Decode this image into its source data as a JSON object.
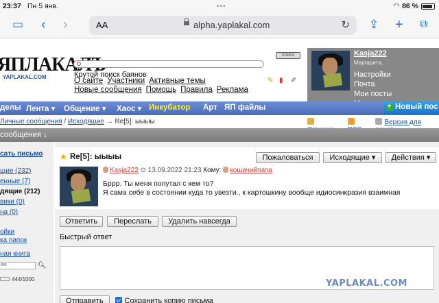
{
  "status": {
    "time": "23:37",
    "date": "Пн 5 янв.",
    "battery": "86 %",
    "battery_level": 0.86
  },
  "browser": {
    "aa": "AA",
    "url": "alpha.yaplakal.com"
  },
  "site": {
    "logo": "ЯПЛАКАЛЪ",
    "logo_sub": "YAPLAKAL.COM",
    "search_toggle": "поиск",
    "search_hint": "Крутой поиск баянов",
    "nav": [
      "О сайте",
      "Участники",
      "Активные темы",
      "Новые сообщения",
      "Помощь",
      "Правила",
      "Реклама"
    ]
  },
  "user": {
    "name": "Kasja222",
    "real_name": "Маргарита...",
    "links": [
      "Настройки",
      "Почта",
      "Мои посты",
      "Мои темы"
    ]
  },
  "menu": {
    "items": [
      "делы",
      "Лента ▾",
      "Общение ▾",
      "Хаос ▾",
      "Инкубатор",
      "Арт",
      "ЯП файлы"
    ],
    "new_post": "Новый пос"
  },
  "breadcrumb": {
    "part1": "Личные сообщения",
    "part2": "Исходящие",
    "current": "→ Re[5]: ыыыы"
  },
  "tools": [
    "Справка",
    "RSS",
    "Версия для печат"
  ],
  "section": "сообщения ↓",
  "sidebar": {
    "write": "сать письмо",
    "folders": [
      {
        "label": "щие (232)",
        "bold": false
      },
      {
        "label": "енные (7)",
        "bold": false
      },
      {
        "label": "дящие (212)",
        "bold": true
      },
      {
        "label": "вики (0)",
        "bold": false
      },
      {
        "label": "на (0)",
        "bold": false
      }
    ],
    "links": [
      "ойки",
      "ка папок"
    ],
    "contacts": "ная книга",
    "search_placeholder": "ем",
    "quota": "444/1000"
  },
  "message": {
    "title": "Re[5]: ыыыы",
    "buttons": {
      "complain": "Пожаловаться",
      "outgoing": "Исходящие ▾",
      "actions": "Действия ▾"
    },
    "from": "Kasja222",
    "datetime": "13.09.2022 21:23",
    "to_label": "Кому:",
    "to": "кошачийпапа",
    "body_line1": "Бррр. Ты меня попутал с кем то?",
    "body_line2": "Я сама себе в состоянии куда то увезти., к картошкину вообще идиосинкразия взаимная"
  },
  "actions": {
    "reply": "Ответить",
    "forward": "Переслать",
    "delete": "Удалить навсегда"
  },
  "quick_reply": {
    "label": "Быстрый ответ",
    "send": "Отправить",
    "save_copy": "Сохранить копию письма"
  },
  "watermark": "YAPLAKAL.COM"
}
